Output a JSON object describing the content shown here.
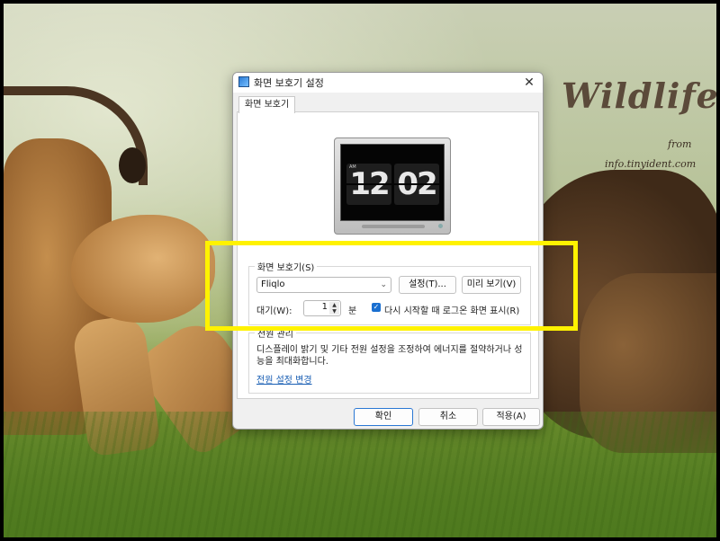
{
  "wallpaper": {
    "title": "Wildlife",
    "from": "from",
    "site": "info.tinyident.com"
  },
  "dialog": {
    "title": "화면 보호기 설정",
    "close_icon": "close-icon",
    "tab_label": "화면 보호기",
    "preview": {
      "hour": "12",
      "minute": "02",
      "ampm": "AM"
    },
    "screensaver_group": {
      "legend": "화면 보호기(S)",
      "selected": "Fliqlo",
      "settings_label": "설정(T)...",
      "preview_label": "미리 보기(V)",
      "wait_label": "대기(W):",
      "wait_value": "1",
      "unit_label": "분",
      "resume_checked": true,
      "resume_label": "다시 시작할 때 로그온 화면 표시(R)"
    },
    "power_group": {
      "legend": "전원 관리",
      "description": "디스플레이 밝기 및 기타 전원 설정을 조정하여 에너지를 절약하거나 성능을 최대화합니다.",
      "link": "전원 설정 변경"
    },
    "buttons": {
      "ok": "확인",
      "cancel": "취소",
      "apply": "적용(A)"
    }
  },
  "highlight_color": "#fff200"
}
